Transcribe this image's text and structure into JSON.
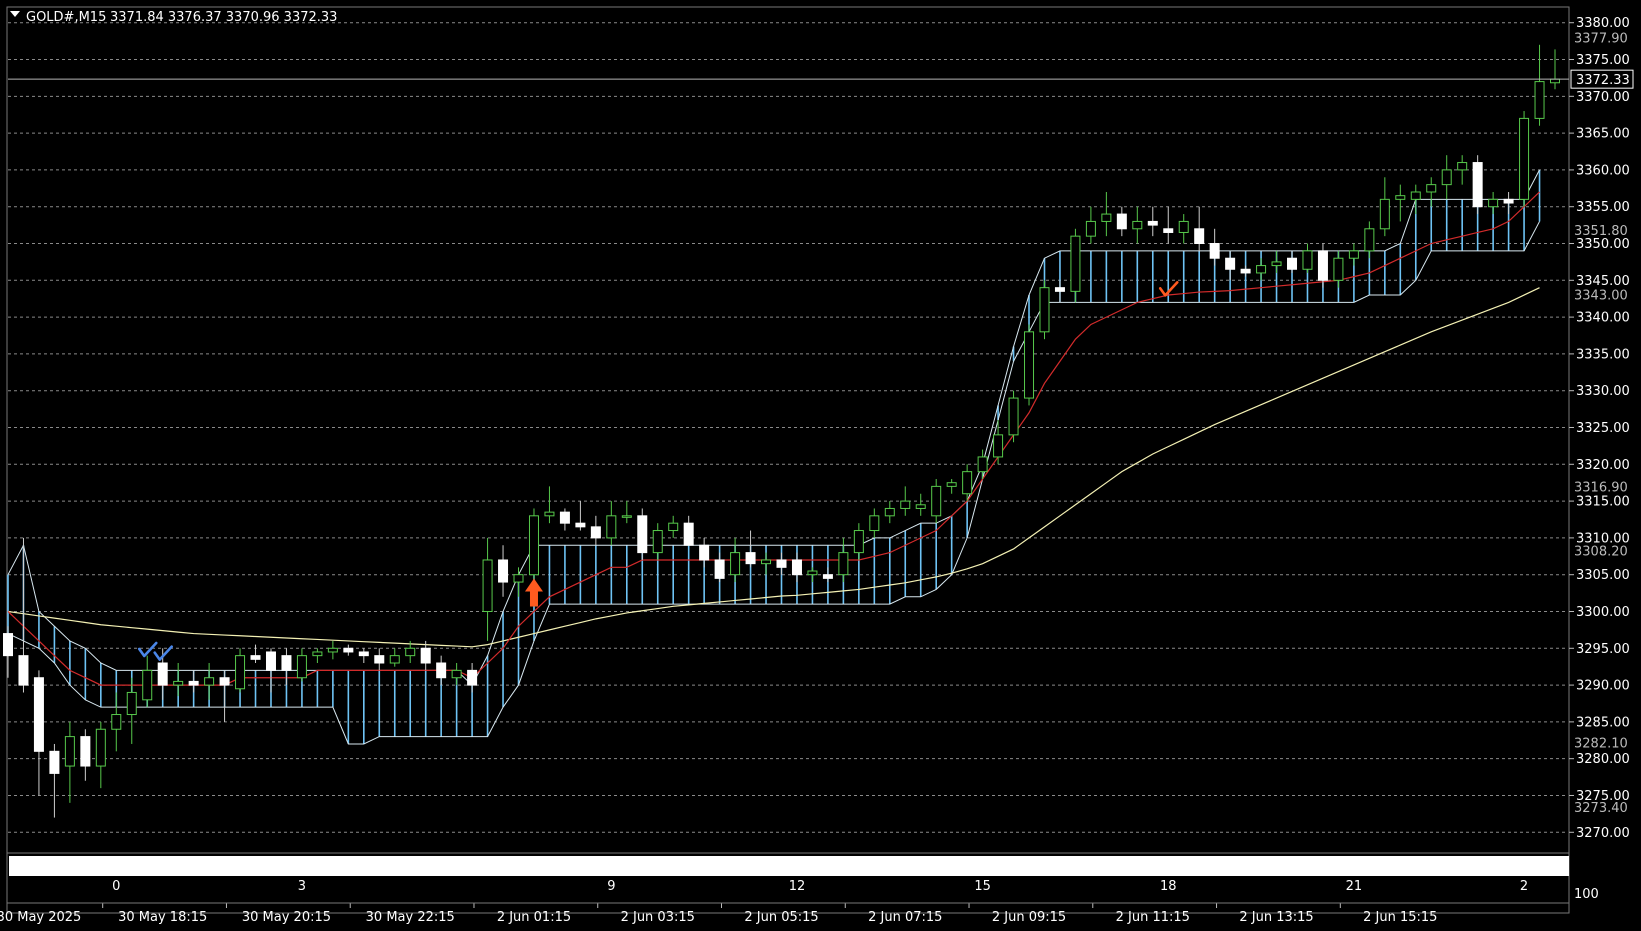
{
  "header": {
    "symbol": "GOLD#,M15",
    "ohlc": "3371.84 3376.37 3370.96 3372.33"
  },
  "colors": {
    "background": "#000000",
    "bull_candle": "#57c94b",
    "bear_candle": "#ffffff",
    "cloud_bull": "#6ec3f5",
    "cloud_bear": "#f0a8a8",
    "ma_fast": "#d22b2b",
    "ma_slow": "#f4f1b4",
    "grid": "#8a8a8a",
    "buy_arrow": "#ff5a1f",
    "check_blue": "#4a86e8",
    "check_red": "#ff5a1f"
  },
  "icons": [
    "dropdown-triangle-icon",
    "buy-arrow-icon",
    "check-mark-icon"
  ],
  "chart_data": {
    "type": "candlestick",
    "timeframe": "M15",
    "ylim": [
      3268,
      3382
    ],
    "grid": true,
    "y_ticks": [
      "3380.00",
      "3375.00",
      "3370.00",
      "3365.00",
      "3360.00",
      "3355.00",
      "3350.00",
      "3345.00",
      "3340.00",
      "3335.00",
      "3330.00",
      "3325.00",
      "3320.00",
      "3315.00",
      "3310.00",
      "3305.00",
      "3300.00",
      "3295.00",
      "3290.00",
      "3285.00",
      "3280.00",
      "3275.00",
      "3270.00"
    ],
    "price_labels": [
      {
        "value": 3377.9,
        "text": "3377.90"
      },
      {
        "value": 3351.8,
        "text": "3351.80"
      },
      {
        "value": 3343.0,
        "text": "3343.00"
      },
      {
        "value": 3316.9,
        "text": "3316.90"
      },
      {
        "value": 3308.2,
        "text": "3308.20"
      },
      {
        "value": 3282.1,
        "text": "3282.10"
      },
      {
        "value": 3273.4,
        "text": "3273.40"
      }
    ],
    "current_price": {
      "value": 3372.33,
      "text": "3372.33"
    },
    "bar_counter": [
      {
        "bar": 7,
        "label": "0"
      },
      {
        "bar": 19,
        "label": "3"
      },
      {
        "bar": 39,
        "label": "9"
      },
      {
        "bar": 51,
        "label": "12"
      },
      {
        "bar": 63,
        "label": "15"
      },
      {
        "bar": 75,
        "label": "18"
      },
      {
        "bar": 87,
        "label": "21"
      },
      {
        "bar": 98,
        "label": "2"
      }
    ],
    "corner_label": "100",
    "time_labels": [
      {
        "bar": 2,
        "label": "30 May 2025"
      },
      {
        "bar": 10,
        "label": "30 May 18:15"
      },
      {
        "bar": 18,
        "label": "30 May 20:15"
      },
      {
        "bar": 26,
        "label": "30 May 22:15"
      },
      {
        "bar": 34,
        "label": "2 Jun 01:15"
      },
      {
        "bar": 42,
        "label": "2 Jun 03:15"
      },
      {
        "bar": 50,
        "label": "2 Jun 05:15"
      },
      {
        "bar": 58,
        "label": "2 Jun 07:15"
      },
      {
        "bar": 66,
        "label": "2 Jun 09:15"
      },
      {
        "bar": 74,
        "label": "2 Jun 11:15"
      },
      {
        "bar": 82,
        "label": "2 Jun 13:15"
      },
      {
        "bar": 90,
        "label": "2 Jun 15:15"
      }
    ],
    "candles": [
      [
        3297.0,
        3298.0,
        3291.0,
        3294.0
      ],
      [
        3294.0,
        3310.0,
        3289.0,
        3290.0
      ],
      [
        3291.0,
        3292.0,
        3275.0,
        3281.0
      ],
      [
        3281.0,
        3282.0,
        3272.0,
        3278.0
      ],
      [
        3279.0,
        3285.0,
        3274.0,
        3283.0
      ],
      [
        3283.0,
        3284.0,
        3277.0,
        3279.0
      ],
      [
        3279.0,
        3285.0,
        3276.0,
        3284.0
      ],
      [
        3284.0,
        3289.0,
        3281.0,
        3286.0
      ],
      [
        3286.0,
        3291.0,
        3282.0,
        3289.0
      ],
      [
        3288.0,
        3294.0,
        3287.0,
        3292.0
      ],
      [
        3293.0,
        3295.0,
        3288.0,
        3290.0
      ],
      [
        3290.0,
        3293.0,
        3288.5,
        3290.5
      ],
      [
        3290.5,
        3292.0,
        3289.0,
        3290.0
      ],
      [
        3290.0,
        3293.0,
        3288.0,
        3291.0
      ],
      [
        3291.0,
        3292.0,
        3285.0,
        3290.0
      ],
      [
        3289.5,
        3295.0,
        3289.0,
        3294.0
      ],
      [
        3294.0,
        3295.5,
        3293.0,
        3293.5
      ],
      [
        3294.5,
        3295.0,
        3289.0,
        3292.0
      ],
      [
        3294.0,
        3295.0,
        3290.0,
        3292.0
      ],
      [
        3291.0,
        3295.0,
        3290.5,
        3294.0
      ],
      [
        3294.0,
        3295.0,
        3293.0,
        3294.5
      ],
      [
        3294.5,
        3296.0,
        3293.5,
        3295.0
      ],
      [
        3295.0,
        3295.5,
        3294.0,
        3294.5
      ],
      [
        3294.5,
        3295.0,
        3293.0,
        3294.0
      ],
      [
        3294.0,
        3295.0,
        3292.0,
        3293.0
      ],
      [
        3293.0,
        3295.0,
        3292.5,
        3294.0
      ],
      [
        3294.0,
        3296.0,
        3293.0,
        3295.0
      ],
      [
        3295.0,
        3296.0,
        3292.0,
        3293.0
      ],
      [
        3293.0,
        3294.0,
        3290.0,
        3291.0
      ],
      [
        3291.0,
        3293.0,
        3290.0,
        3292.0
      ],
      [
        3292.0,
        3293.0,
        3289.0,
        3290.0
      ],
      [
        3300.0,
        3310.0,
        3296.0,
        3307.0
      ],
      [
        3307.0,
        3309.0,
        3302.0,
        3304.0
      ],
      [
        3304.0,
        3306.0,
        3302.0,
        3305.0
      ],
      [
        3305.0,
        3314.0,
        3301.0,
        3313.0
      ],
      [
        3313.0,
        3317.0,
        3312.0,
        3313.5
      ],
      [
        3313.5,
        3314.0,
        3311.0,
        3312.0
      ],
      [
        3312.0,
        3315.0,
        3311.0,
        3311.5
      ],
      [
        3311.5,
        3313.0,
        3309.0,
        3310.0
      ],
      [
        3310.0,
        3315.0,
        3309.0,
        3313.0
      ],
      [
        3313.0,
        3315.0,
        3312.0,
        3313.0
      ],
      [
        3313.0,
        3314.0,
        3307.0,
        3308.0
      ],
      [
        3308.0,
        3312.0,
        3307.0,
        3311.0
      ],
      [
        3311.0,
        3313.0,
        3310.0,
        3312.0
      ],
      [
        3312.0,
        3313.0,
        3309.0,
        3309.0
      ],
      [
        3309.0,
        3310.0,
        3306.0,
        3307.0
      ],
      [
        3307.0,
        3308.0,
        3304.0,
        3304.5
      ],
      [
        3305.0,
        3310.0,
        3304.0,
        3308.0
      ],
      [
        3308.0,
        3311.0,
        3306.0,
        3306.5
      ],
      [
        3306.5,
        3308.0,
        3305.0,
        3307.0
      ],
      [
        3307.0,
        3308.0,
        3305.0,
        3306.0
      ],
      [
        3307.0,
        3308.0,
        3304.0,
        3305.0
      ],
      [
        3305.0,
        3306.0,
        3304.0,
        3305.5
      ],
      [
        3305.0,
        3306.0,
        3304.0,
        3304.5
      ],
      [
        3305.0,
        3310.0,
        3304.0,
        3308.0
      ],
      [
        3308.0,
        3312.0,
        3307.0,
        3311.0
      ],
      [
        3311.0,
        3314.0,
        3310.0,
        3313.0
      ],
      [
        3313.0,
        3315.0,
        3312.0,
        3314.0
      ],
      [
        3314.0,
        3317.0,
        3313.0,
        3315.0
      ],
      [
        3314.0,
        3316.0,
        3313.0,
        3314.5
      ],
      [
        3313.0,
        3318.0,
        3312.0,
        3317.0
      ],
      [
        3317.0,
        3318.0,
        3316.0,
        3317.5
      ],
      [
        3316.0,
        3320.0,
        3315.0,
        3319.0
      ],
      [
        3319.0,
        3322.0,
        3318.0,
        3321.0
      ],
      [
        3321.0,
        3326.0,
        3320.0,
        3324.0
      ],
      [
        3324.0,
        3330.0,
        3323.0,
        3329.0
      ],
      [
        3329.0,
        3339.0,
        3328.0,
        3338.0
      ],
      [
        3338.0,
        3345.0,
        3337.0,
        3344.0
      ],
      [
        3344.0,
        3345.0,
        3342.0,
        3343.5
      ],
      [
        3343.5,
        3352.0,
        3342.0,
        3351.0
      ],
      [
        3351.0,
        3355.0,
        3350.0,
        3353.0
      ],
      [
        3353.0,
        3357.0,
        3351.0,
        3354.0
      ],
      [
        3354.0,
        3355.0,
        3351.0,
        3352.0
      ],
      [
        3352.0,
        3355.0,
        3350.0,
        3353.0
      ],
      [
        3353.0,
        3355.0,
        3351.0,
        3352.5
      ],
      [
        3352.0,
        3355.0,
        3350.0,
        3351.5
      ],
      [
        3351.5,
        3354.0,
        3350.0,
        3353.0
      ],
      [
        3352.0,
        3355.0,
        3349.0,
        3350.0
      ],
      [
        3350.0,
        3352.0,
        3347.0,
        3348.0
      ],
      [
        3348.0,
        3349.0,
        3345.0,
        3346.5
      ],
      [
        3346.5,
        3347.0,
        3345.5,
        3346.0
      ],
      [
        3346.0,
        3348.0,
        3345.0,
        3347.0
      ],
      [
        3347.0,
        3349.0,
        3346.0,
        3347.5
      ],
      [
        3348.0,
        3349.0,
        3346.0,
        3346.5
      ],
      [
        3346.5,
        3350.0,
        3346.0,
        3349.0
      ],
      [
        3349.0,
        3350.0,
        3344.0,
        3345.0
      ],
      [
        3345.0,
        3349.0,
        3344.0,
        3348.0
      ],
      [
        3348.0,
        3350.0,
        3347.0,
        3349.0
      ],
      [
        3349.0,
        3353.0,
        3348.0,
        3352.0
      ],
      [
        3352.0,
        3359.0,
        3351.0,
        3356.0
      ],
      [
        3356.0,
        3358.0,
        3353.0,
        3356.5
      ],
      [
        3356.0,
        3358.0,
        3354.0,
        3357.0
      ],
      [
        3357.0,
        3359.0,
        3355.0,
        3358.0
      ],
      [
        3358.0,
        3362.0,
        3356.0,
        3360.0
      ],
      [
        3360.0,
        3362.0,
        3358.0,
        3361.0
      ],
      [
        3361.0,
        3362.0,
        3354.0,
        3355.0
      ],
      [
        3355.0,
        3357.0,
        3354.0,
        3356.0
      ],
      [
        3356.0,
        3357.0,
        3354.0,
        3355.5
      ],
      [
        3356.0,
        3368.0,
        3355.0,
        3367.0
      ],
      [
        3367.0,
        3377.0,
        3366.0,
        3372.0
      ],
      [
        3371.84,
        3376.37,
        3370.96,
        3372.33
      ]
    ],
    "ichimoku_cloud": {
      "start_bar": 0,
      "span_a": [
        3305,
        3309,
        3300,
        3298,
        3296,
        3295,
        3293,
        3292,
        3292,
        3292,
        3292,
        3292,
        3292,
        3292,
        3292,
        3292,
        3292,
        3292,
        3292,
        3292,
        3292,
        3292,
        3292,
        3292,
        3292,
        3292,
        3292,
        3292,
        3292,
        3292,
        3290,
        3294,
        3300,
        3305,
        3309,
        3309,
        3309,
        3309,
        3309,
        3309,
        3309,
        3309,
        3309,
        3309,
        3309,
        3309,
        3309,
        3309,
        3309,
        3309,
        3309,
        3309,
        3309,
        3309,
        3309,
        3309,
        3310,
        3310,
        3311,
        3312,
        3312,
        3313,
        3315,
        3320,
        3328,
        3336,
        3343,
        3348,
        3349,
        3349,
        3349,
        3349,
        3349,
        3349,
        3349,
        3349,
        3349,
        3349,
        3349,
        3349,
        3349,
        3349,
        3349,
        3349,
        3349,
        3349,
        3349,
        3349,
        3349,
        3349,
        3350,
        3356,
        3356,
        3356,
        3356,
        3356,
        3356,
        3356,
        3356,
        3360
      ],
      "span_b": [
        3297,
        3296,
        3295,
        3293,
        3290,
        3288,
        3287,
        3287,
        3287,
        3287,
        3287,
        3287,
        3287,
        3287,
        3287,
        3287,
        3287,
        3287,
        3287,
        3287,
        3287,
        3287,
        3282,
        3282,
        3283,
        3283,
        3283,
        3283,
        3283,
        3283,
        3283,
        3283,
        3287,
        3290,
        3296,
        3301,
        3301,
        3301,
        3301,
        3301,
        3301,
        3301,
        3301,
        3301,
        3301,
        3301,
        3301,
        3301,
        3301,
        3301,
        3301,
        3301,
        3301,
        3301,
        3301,
        3301,
        3301,
        3301,
        3302,
        3302,
        3303,
        3305,
        3310,
        3318,
        3326,
        3334,
        3338,
        3342,
        3342,
        3342,
        3342,
        3342,
        3342,
        3342,
        3342,
        3342,
        3342,
        3342,
        3342,
        3342,
        3342,
        3342,
        3342,
        3342,
        3342,
        3342,
        3342,
        3342,
        3343,
        3343,
        3343,
        3345,
        3349,
        3349,
        3349,
        3349,
        3349,
        3349,
        3349,
        3353
      ]
    },
    "ma_fast": [
      3300,
      3298,
      3296,
      3294,
      3292,
      3291,
      3290,
      3290,
      3290,
      3290,
      3290,
      3290,
      3290,
      3290,
      3290,
      3291,
      3291,
      3291,
      3291,
      3291,
      3292,
      3292,
      3292,
      3292,
      3292,
      3292,
      3292,
      3292,
      3292,
      3292,
      3291,
      3293,
      3295,
      3298,
      3300,
      3302,
      3303,
      3304,
      3305,
      3306,
      3306,
      3307,
      3307,
      3307,
      3307,
      3307,
      3307,
      3307,
      3307,
      3307,
      3307,
      3307,
      3307,
      3307,
      3307,
      3307,
      3307.5,
      3308,
      3309,
      3310,
      3311,
      3313,
      3315,
      3318,
      3321,
      3324,
      3327,
      3331,
      3334,
      3337,
      3339,
      3340,
      3341,
      3342,
      3342.5,
      3343,
      3343.2,
      3343.4,
      3343.5,
      3343.6,
      3343.8,
      3344,
      3344.2,
      3344.4,
      3344.6,
      3344.8,
      3345,
      3345.5,
      3346,
      3347,
      3348,
      3349,
      3350,
      3350.5,
      3351,
      3351.5,
      3352,
      3353,
      3355,
      3357
    ],
    "ma_slow": [
      3300,
      3299.7,
      3299.4,
      3299.1,
      3298.8,
      3298.5,
      3298.2,
      3298,
      3297.8,
      3297.6,
      3297.4,
      3297.2,
      3297,
      3296.9,
      3296.8,
      3296.7,
      3296.6,
      3296.5,
      3296.4,
      3296.3,
      3296.2,
      3296.1,
      3296,
      3295.9,
      3295.8,
      3295.7,
      3295.6,
      3295.5,
      3295.4,
      3295.3,
      3295.2,
      3295.5,
      3296,
      3296.5,
      3297,
      3297.5,
      3298,
      3298.5,
      3299,
      3299.4,
      3299.8,
      3300.1,
      3300.4,
      3300.7,
      3300.9,
      3301.1,
      3301.3,
      3301.5,
      3301.7,
      3301.9,
      3302.1,
      3302.2,
      3302.4,
      3302.6,
      3302.8,
      3303,
      3303.3,
      3303.6,
      3303.9,
      3304.3,
      3304.7,
      3305.2,
      3305.8,
      3306.5,
      3307.5,
      3308.5,
      3310,
      3311.5,
      3313,
      3314.5,
      3316,
      3317.5,
      3319,
      3320.2,
      3321.4,
      3322.4,
      3323.4,
      3324.4,
      3325.4,
      3326.3,
      3327.2,
      3328.1,
      3329,
      3329.9,
      3330.8,
      3331.7,
      3332.6,
      3333.5,
      3334.4,
      3335.3,
      3336.2,
      3337.1,
      3338,
      3338.8,
      3339.6,
      3340.4,
      3341.2,
      3342,
      3343,
      3344
    ],
    "signals": [
      {
        "type": "buy-arrow",
        "bar": 34,
        "price": 3301.5
      },
      {
        "type": "check-blue",
        "bar": 9,
        "price": 3294.5
      },
      {
        "type": "check-blue",
        "bar": 10,
        "price": 3294.0
      },
      {
        "type": "check-red",
        "bar": 75,
        "price": 3343.5
      }
    ],
    "volume_hint": {
      "from_bar": 67,
      "to_bar": 74
    }
  }
}
